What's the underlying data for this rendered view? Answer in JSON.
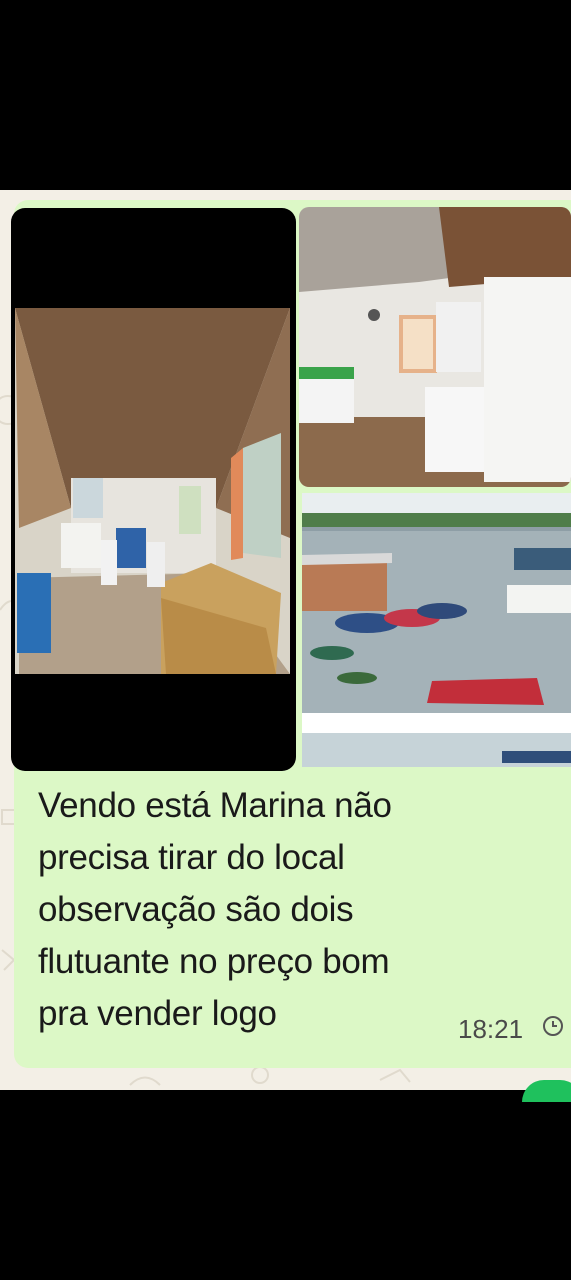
{
  "message": {
    "text": "Vendo está Marina não\nprecisa tirar do local\nobservação são dois\nflutuante no preço bom\npra vender logo",
    "time": "18:21",
    "status_icon": "clock-icon"
  },
  "photos": [
    {
      "subject": "houseboat-interior-living-room"
    },
    {
      "subject": "houseboat-kitchen"
    },
    {
      "subject": "marina-with-boats-on-river"
    }
  ],
  "colors": {
    "bubble": "#dcf8c6",
    "chat_wallpaper": "#f3efe6",
    "screen_frame": "#000000"
  }
}
